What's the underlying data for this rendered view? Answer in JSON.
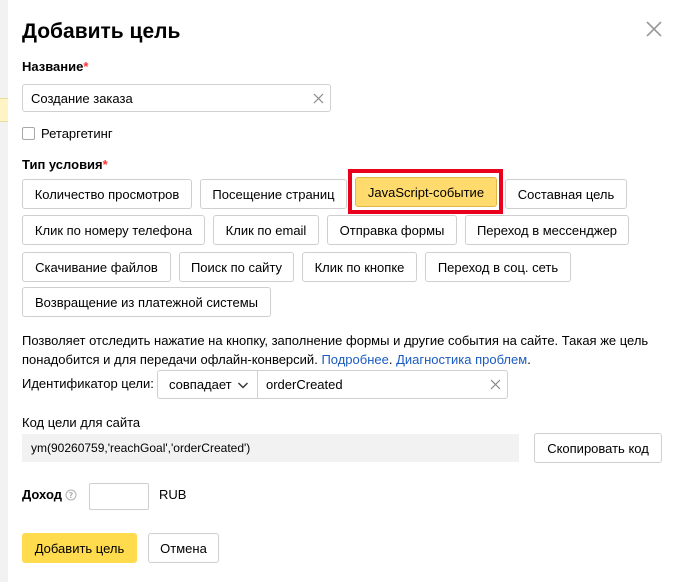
{
  "dialog": {
    "title": "Добавить цель",
    "close_icon": "close-icon"
  },
  "name_field": {
    "label": "Название",
    "required_mark": "*",
    "value": "Создание заказа"
  },
  "retargeting": {
    "label": "Ретаргетинг",
    "checked": false
  },
  "condition": {
    "label": "Тип условия",
    "required_mark": "*",
    "options": [
      "Количество просмотров",
      "Посещение страниц",
      "JavaScript-событие",
      "Составная цель",
      "Клик по номеру телефона",
      "Клик по email",
      "Отправка формы",
      "Переход в мессенджер",
      "Скачивание файлов",
      "Поиск по сайту",
      "Клик по кнопке",
      "Переход в соц. сеть",
      "Возвращение из платежной системы"
    ],
    "selected": "JavaScript-событие"
  },
  "description": {
    "text": "Позволяет отследить нажатие на кнопку, заполнение формы и другие события на сайте. Такая же цель понадобится и для передачи офлайн-конверсий.",
    "more_link": "Подробнее",
    "diag_link": "Диагностика проблем"
  },
  "identifier": {
    "label": "Идентификатор цели:",
    "match_type": "совпадает",
    "value": "orderCreated"
  },
  "goal_code": {
    "label": "Код цели для сайта",
    "code": "ym(90260759,'reachGoal','orderCreated')",
    "copy_label": "Скопировать код"
  },
  "income": {
    "label": "Доход",
    "currency": "RUB",
    "value": ""
  },
  "footer": {
    "submit_label": "Добавить цель",
    "cancel_label": "Отмена"
  },
  "colors": {
    "selected_bg": "#ffdb6e",
    "highlight_border": "#e8001c",
    "link": "#1a5bbf",
    "primary_bg": "#ffdb4d",
    "required": "#ff3333"
  }
}
